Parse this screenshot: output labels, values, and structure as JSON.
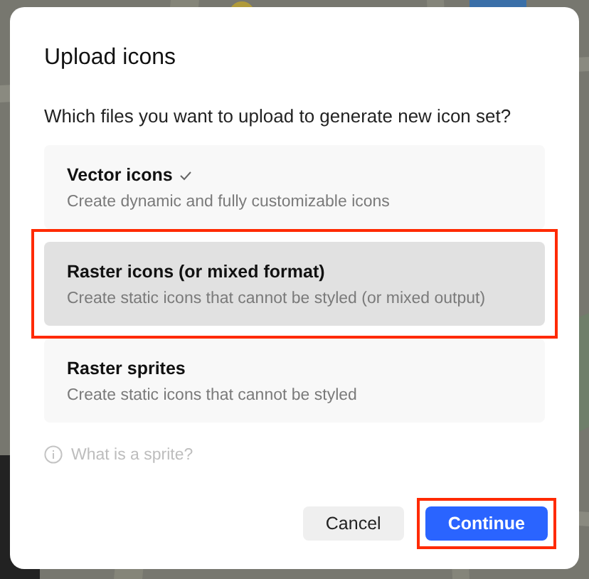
{
  "dialog": {
    "title": "Upload icons",
    "question": "Which files you want to upload to generate new icon set?",
    "options": [
      {
        "title": "Vector icons",
        "description": "Create dynamic and fully customizable icons",
        "checked": true,
        "selected": false,
        "highlighted": false
      },
      {
        "title": "Raster icons (or mixed format)",
        "description": "Create static icons that cannot be styled (or mixed output)",
        "checked": false,
        "selected": true,
        "highlighted": true
      },
      {
        "title": "Raster sprites",
        "description": "Create static icons that cannot be styled",
        "checked": false,
        "selected": false,
        "highlighted": false
      }
    ],
    "info_link": "What is a sprite?",
    "buttons": [
      {
        "label": "Cancel",
        "kind": "secondary",
        "highlighted": false
      },
      {
        "label": "Continue",
        "kind": "primary",
        "highlighted": true
      }
    ]
  }
}
